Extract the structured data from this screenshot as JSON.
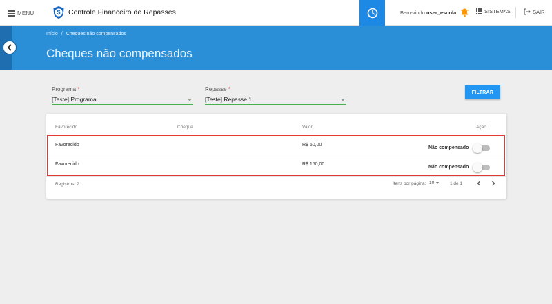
{
  "header": {
    "menu_label": "MENU",
    "app_title": "Controle Financeiro de Repasses",
    "welcome_prefix": "Bem-vindo",
    "username": "user_escola",
    "systems_label": "SISTEMAS",
    "logout_label": "SAIR",
    "icons": [
      "hamburger-icon",
      "dollar-shield-logo",
      "clock-icon",
      "bell-icon",
      "apps-grid-icon",
      "logout-icon"
    ],
    "colors": {
      "clock_bg": "#1e88e5",
      "bell": "#ff9800"
    }
  },
  "band": {
    "breadcrumb": [
      "Início",
      "/",
      "Cheques não compensados"
    ],
    "title": "Cheques não compensados",
    "color": "#2b8fd8"
  },
  "filters": {
    "programa": {
      "label": "Programa",
      "required_mark": "*",
      "value": "[Teste] Programa"
    },
    "repasse": {
      "label": "Repasse",
      "required_mark": "*",
      "value": "[Teste] Repasse 1"
    },
    "filter_button": "FILTRAR"
  },
  "table": {
    "columns": [
      "Favorecido",
      "Cheque",
      "Valor",
      "Ação"
    ],
    "rows": [
      {
        "favorecido": "Favorecido",
        "cheque": "",
        "valor": "R$ 50,00",
        "status": "Não compensado",
        "toggle_on": false
      },
      {
        "favorecido": "Favorecido",
        "cheque": "",
        "valor": "R$ 150,00",
        "status": "Não compensado",
        "toggle_on": false
      }
    ],
    "footer": {
      "records_label": "Registros: 2",
      "per_page_label": "Itens por página:",
      "per_page_value": "10",
      "page_info": "1 de 1"
    }
  }
}
